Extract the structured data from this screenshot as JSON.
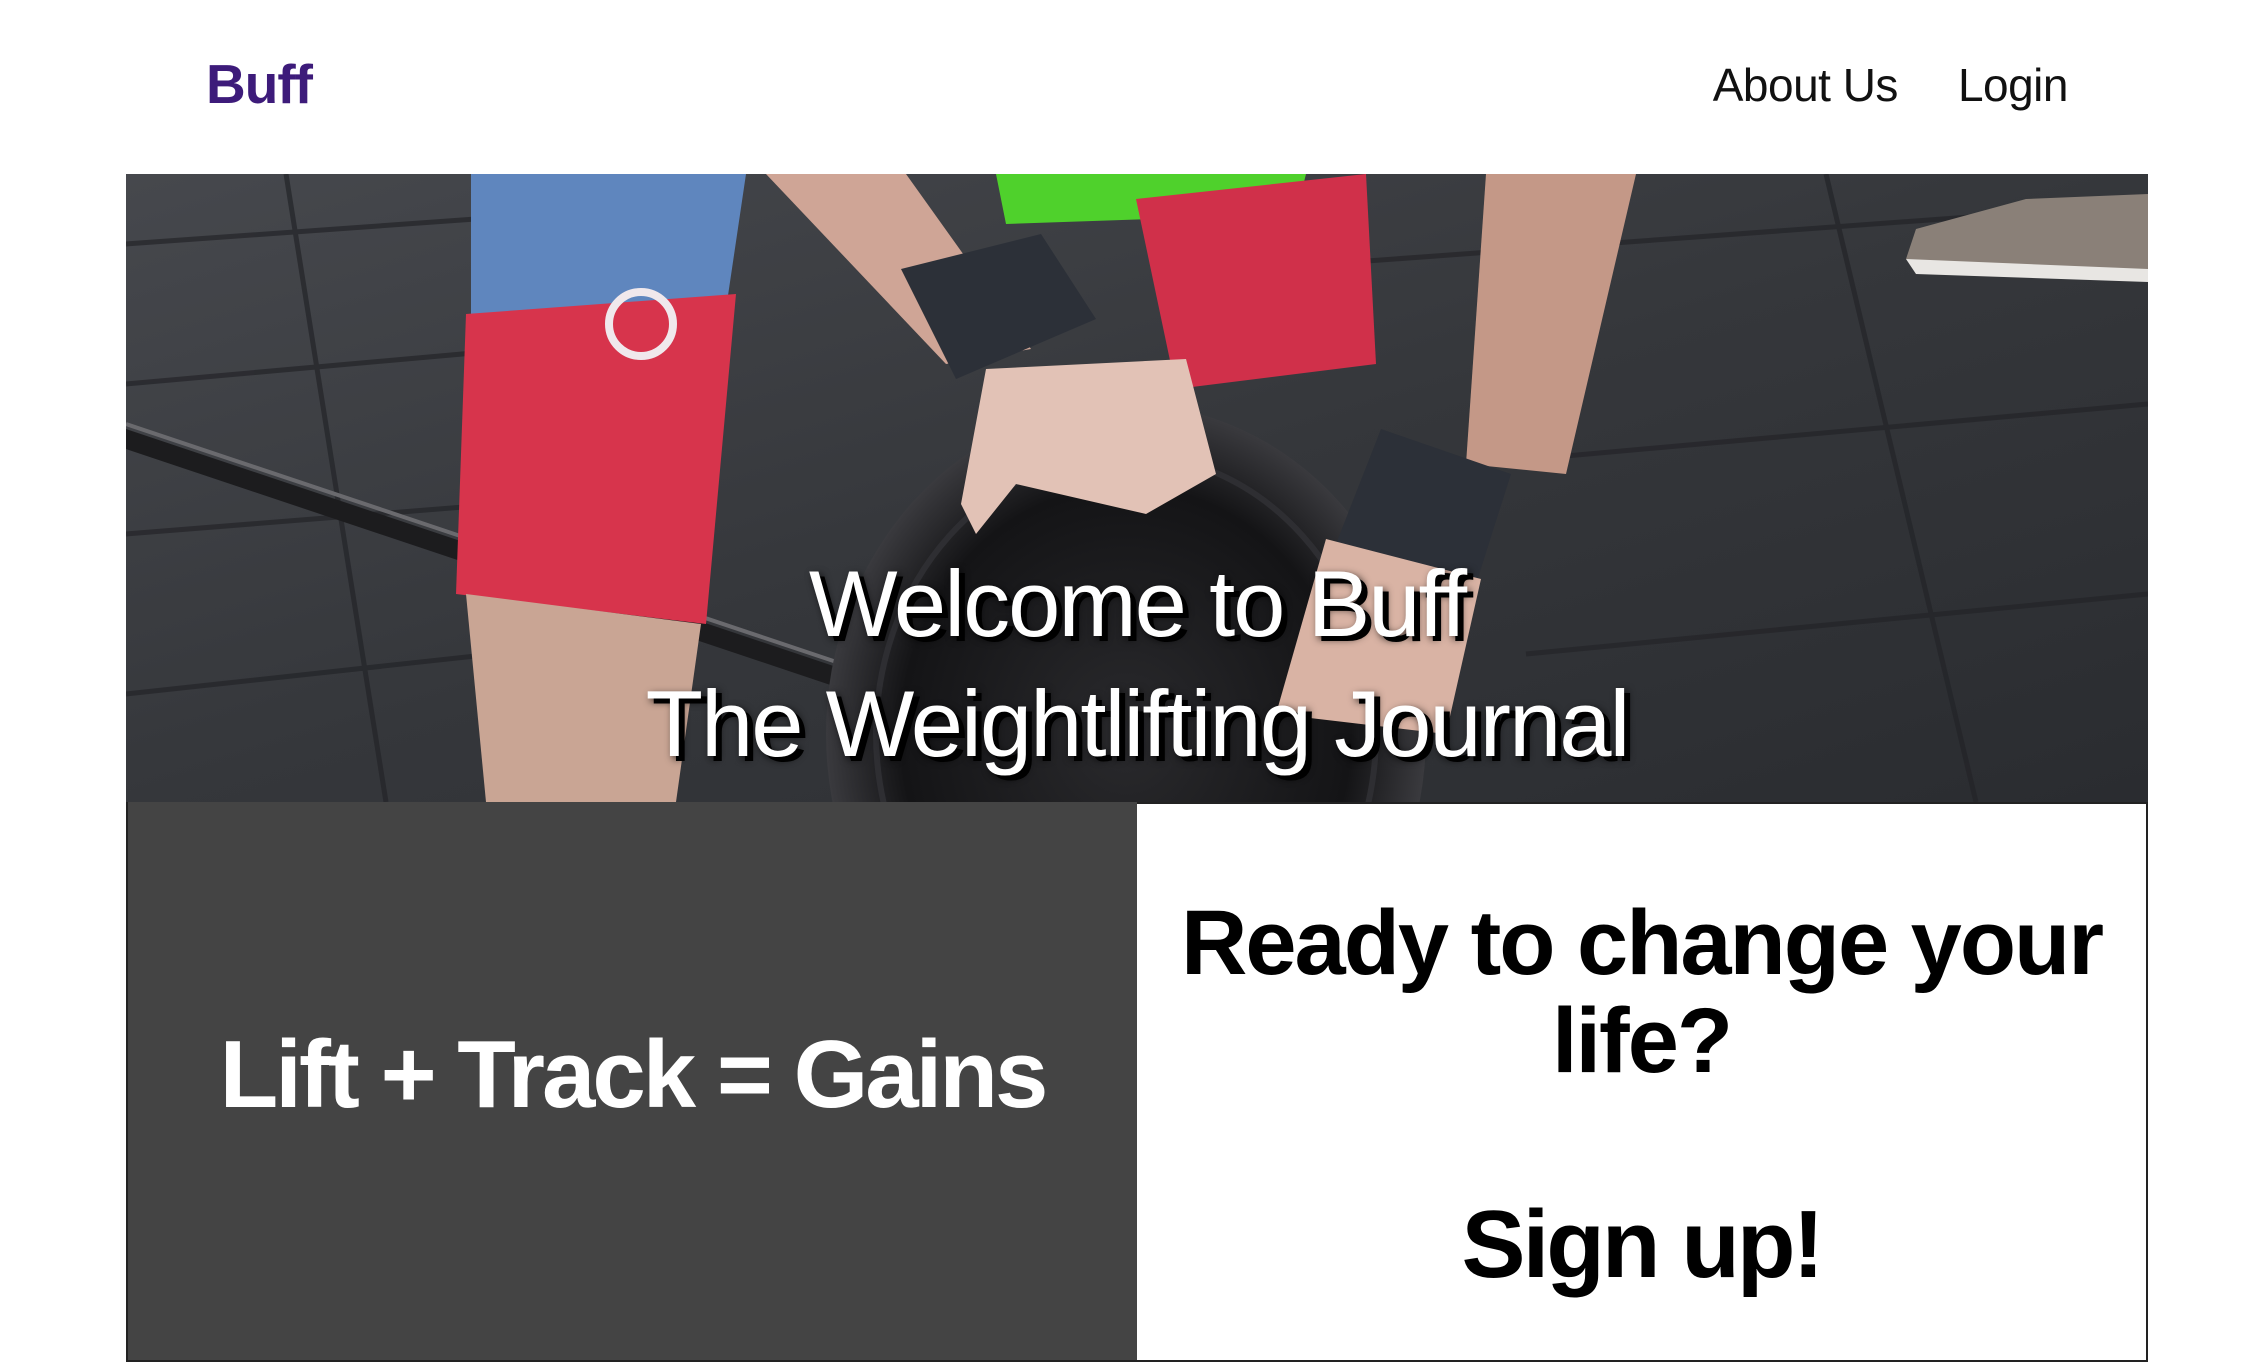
{
  "header": {
    "brand": "Buff",
    "nav": [
      {
        "label": "About Us"
      },
      {
        "label": "Login"
      }
    ]
  },
  "hero": {
    "title_line1": "Welcome to Buff",
    "title_line2": "The Weightlifting Journal",
    "image": "gym-deadlift-photo"
  },
  "panels": {
    "left": {
      "text": "Lift + Track = Gains"
    },
    "right": {
      "question": "Ready to change your life?",
      "signup_label": "Sign up!"
    }
  },
  "colors": {
    "brand": "#3d1b7a",
    "dark_panel": "#444444",
    "text": "#111111"
  }
}
